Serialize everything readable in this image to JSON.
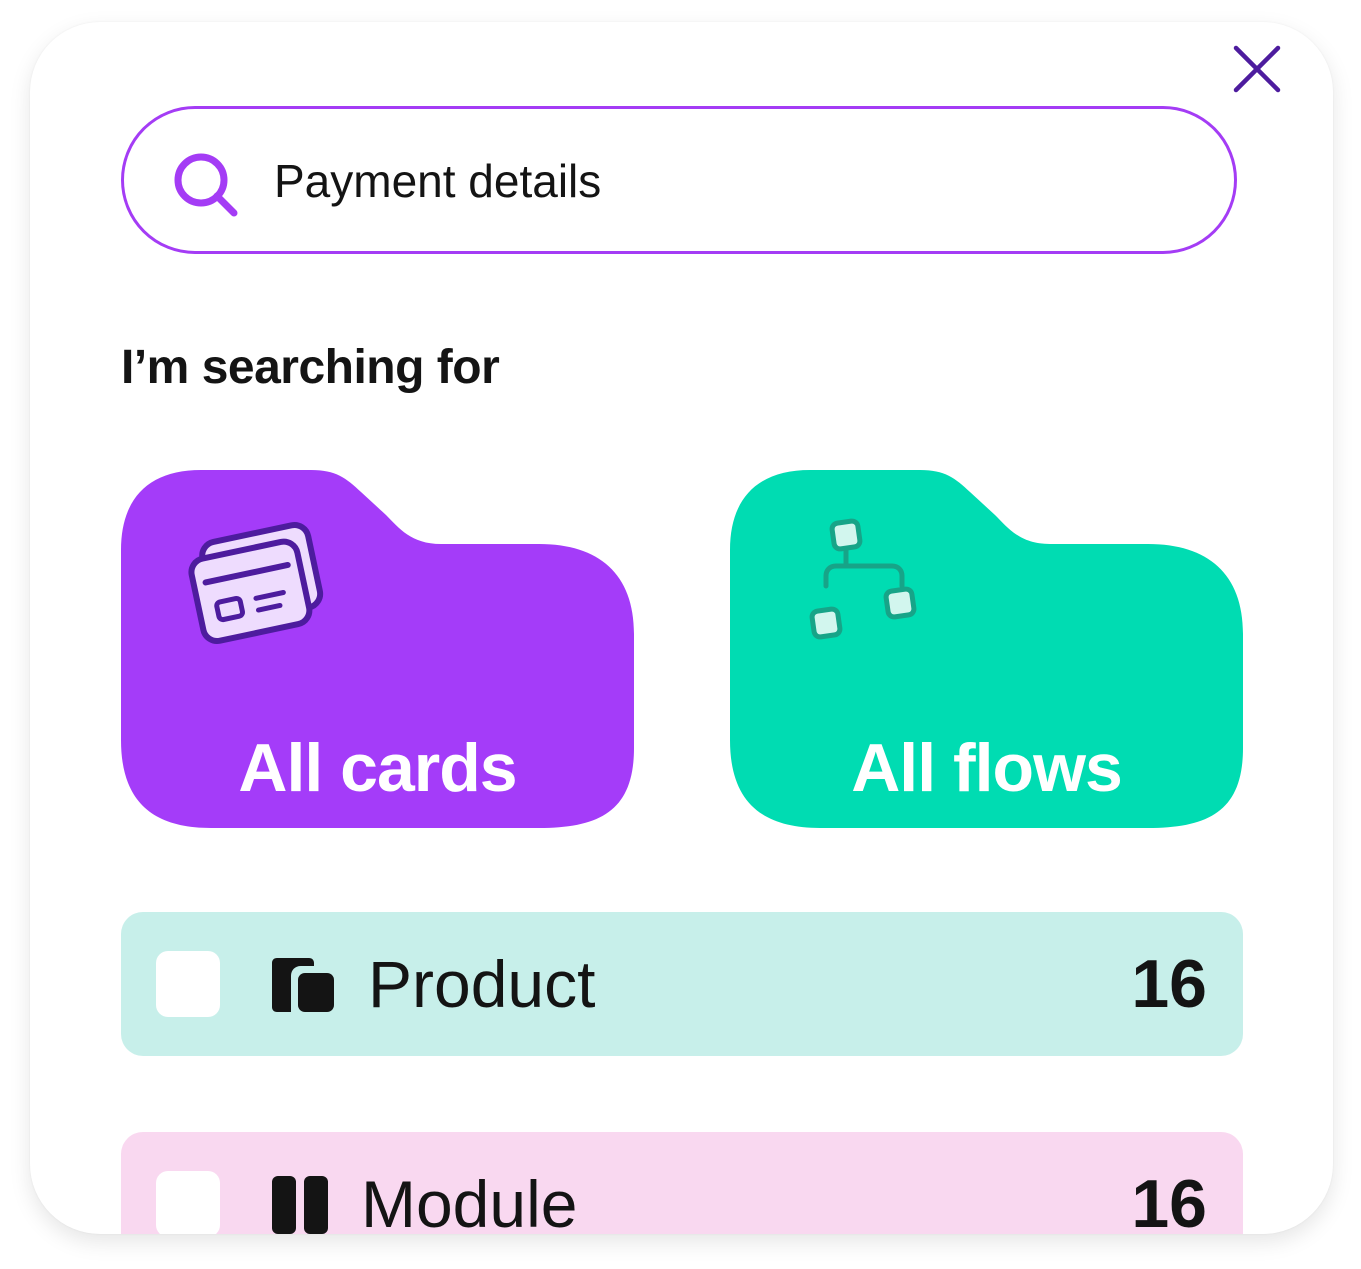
{
  "search": {
    "value": "Payment details",
    "icon": "search-icon"
  },
  "close_icon": "close-icon",
  "section_heading": "I’m searching for",
  "folders": [
    {
      "label": "All cards",
      "icon": "credit-card-icon",
      "color": "#a43cf9"
    },
    {
      "label": "All flows",
      "icon": "flow-diagram-icon",
      "color": "#00dcb2"
    }
  ],
  "filters": [
    {
      "label": "Product",
      "count": "16",
      "icon": "product-icon",
      "color": "#c7efea",
      "checked": false
    },
    {
      "label": "Module",
      "count": "16",
      "icon": "module-icon",
      "color": "#f9d8f0",
      "checked": false
    }
  ],
  "colors": {
    "accent": "#a43cf5",
    "close": "#4d1c9e",
    "text": "#141414"
  }
}
